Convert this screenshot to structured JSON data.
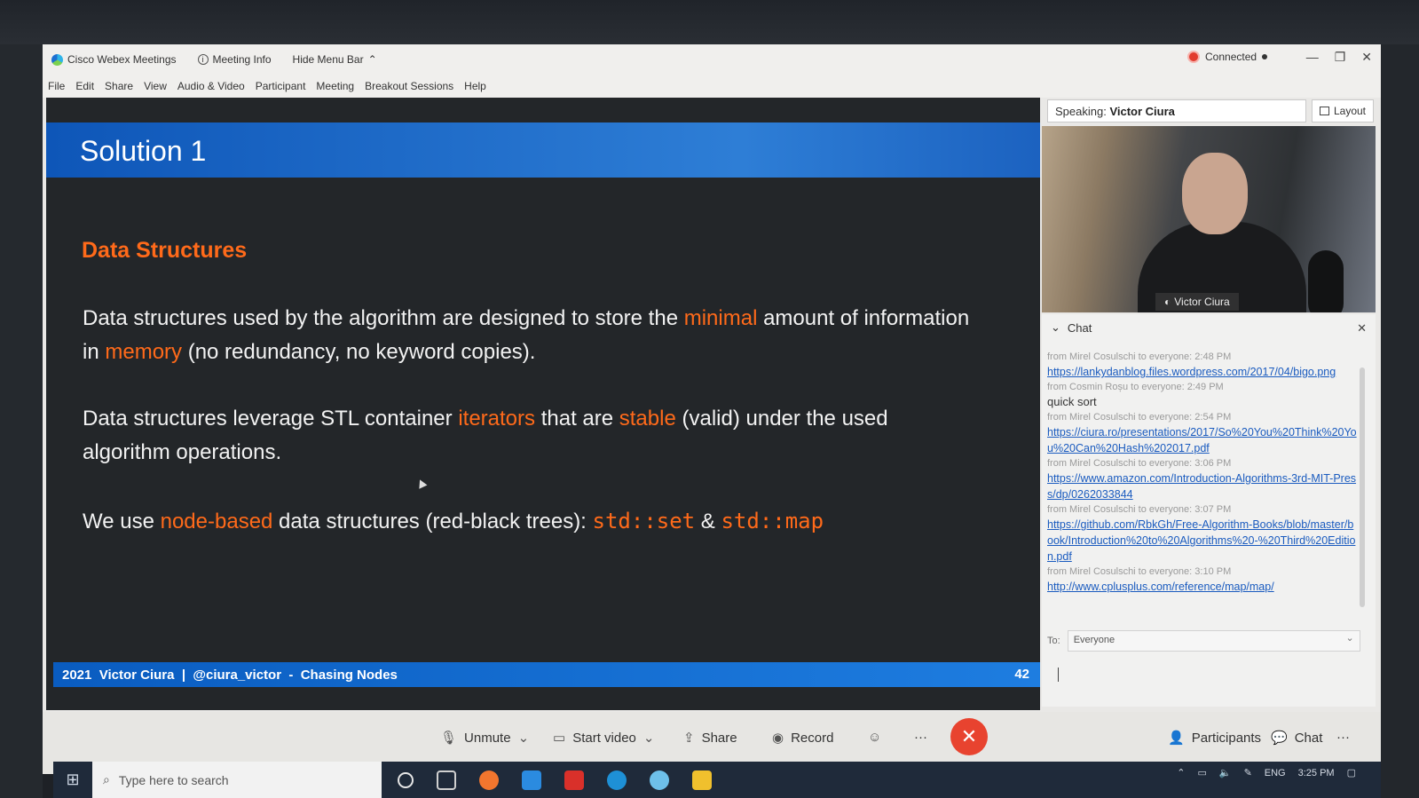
{
  "window": {
    "app_title": "Cisco Webex Meetings",
    "meeting_info": "Meeting Info",
    "hide_menu_bar": "Hide Menu Bar",
    "connected": "Connected"
  },
  "menu": [
    "File",
    "Edit",
    "Share",
    "View",
    "Audio & Video",
    "Participant",
    "Meeting",
    "Breakout Sessions",
    "Help"
  ],
  "slide": {
    "title": "Solution 1",
    "subtitle": "Data Structures",
    "p1": {
      "a": "Data structures used by the algorithm are designed to store the ",
      "h1": "minimal",
      "b": " amount of information in ",
      "h2": "memory",
      "c": " (no redundancy, no keyword copies)."
    },
    "p2": {
      "a": "Data structures leverage STL container ",
      "h1": "iterators",
      "b": " that are ",
      "h2": "stable",
      "c": " (valid) under the used algorithm operations."
    },
    "p3": {
      "a": "We use ",
      "h1": "node-based",
      "b": " data structures (red-black trees): ",
      "code1": "std::set",
      "amp": " & ",
      "code2": "std::map"
    },
    "footer": {
      "year": "2021",
      "author": "Victor Ciura",
      "sep": "|",
      "handle": "@ciura_victor",
      "dash": "-",
      "talk": "Chasing Nodes",
      "page": "42"
    }
  },
  "speaking": {
    "label": "Speaking:",
    "name": "Victor Ciura"
  },
  "layout_label": "Layout",
  "video": {
    "name_tag": "Victor Ciura"
  },
  "chat": {
    "title": "Chat",
    "messages": [
      {
        "meta": "from Mirel Cosulschi to everyone:   2:48 PM",
        "link": "https://lankydanblog.files.wordpress.com/2017/04/bigo.png"
      },
      {
        "meta": "from Cosmin Roșu to everyone:   2:49 PM",
        "text": "quick sort"
      },
      {
        "meta": "from Mirel Cosulschi to everyone:   2:54 PM",
        "link": "https://ciura.ro/presentations/2017/So%20You%20Think%20You%20Can%20Hash%202017.pdf"
      },
      {
        "meta": "from Mirel Cosulschi to everyone:   3:06 PM",
        "link": "https://www.amazon.com/Introduction-Algorithms-3rd-MIT-Press/dp/0262033844"
      },
      {
        "meta": "from Mirel Cosulschi to everyone:   3:07 PM",
        "link": "https://github.com/RbkGh/Free-Algorithm-Books/blob/master/book/Introduction%20to%20Algorithms%20-%20Third%20Edition.pdf"
      },
      {
        "meta": "from Mirel Cosulschi to everyone:   3:10 PM",
        "link": "http://www.cplusplus.com/reference/map/map/"
      }
    ],
    "to_label": "To:",
    "to_value": "Everyone"
  },
  "controls": {
    "unmute": "Unmute",
    "start_video": "Start video",
    "share": "Share",
    "record": "Record",
    "more": "···",
    "participants": "Participants",
    "chat": "Chat"
  },
  "taskbar": {
    "search_placeholder": "Type here to search",
    "lang": "ENG",
    "time": "3:25 PM"
  },
  "colors": {
    "accent_orange": "#ff6a1a",
    "slide_blue": "#1c6fd1",
    "end_red": "#e8432f",
    "link_blue": "#1a5bbf"
  }
}
